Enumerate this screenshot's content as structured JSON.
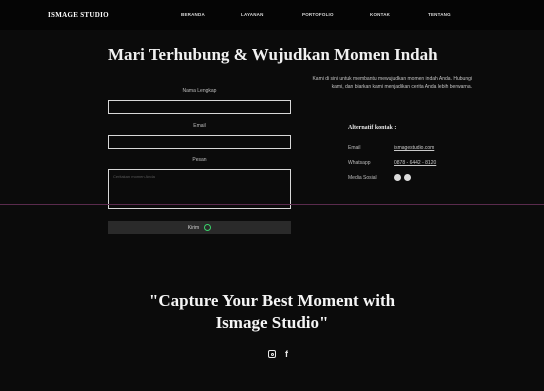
{
  "nav": {
    "brand": "ISMAGE STUDIO",
    "items": [
      "BERANDA",
      "LAYANAN",
      "PORTOFOLIO",
      "KONTAK",
      "TENTANG"
    ]
  },
  "main": {
    "title": "Mari Terhubung & Wujudkan Momen Indah",
    "form": {
      "name_label": "Nama Lengkap",
      "email_label": "Email",
      "message_label": "Pesan",
      "message_placeholder": "Ceritakan momen Anda",
      "submit_label": "Kirim"
    },
    "intro": "Kami di sini untuk membantu mewujudkan momen indah Anda. Hubungi kami, dan biarkan kami menjadikan cerita Anda lebih berwarna.",
    "alt_contact": {
      "title": "Alternatif kontak :",
      "email_label": "Email",
      "email_value": "ismagestudio.com",
      "whatsapp_label": "Whatsapp",
      "whatsapp_value": "0878 - 6442 - 8120",
      "social_label": "Media Sosial"
    }
  },
  "tagline": "\"Capture Your Best Moment with Ismage Studio\"",
  "footer": {
    "icons": [
      "instagram-icon",
      "facebook-icon"
    ]
  }
}
